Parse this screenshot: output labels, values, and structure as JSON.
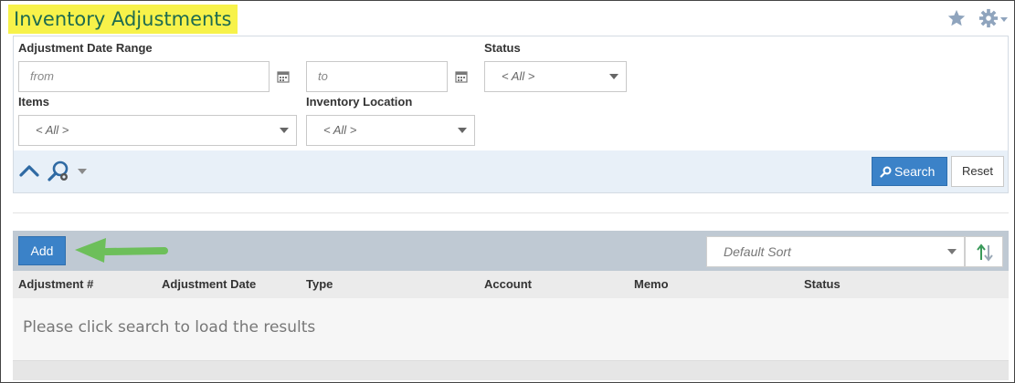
{
  "header": {
    "title": "Inventory Adjustments"
  },
  "filters": {
    "date_range_label": "Adjustment Date Range",
    "from_placeholder": "from",
    "to_placeholder": "to",
    "status_label": "Status",
    "status_value": "< All >",
    "items_label": "Items",
    "items_value": "< All >",
    "location_label": "Inventory Location",
    "location_value": "< All >"
  },
  "actions": {
    "search_label": "Search",
    "reset_label": "Reset"
  },
  "results": {
    "add_label": "Add",
    "sort_value": "Default Sort",
    "columns": [
      "Adjustment #",
      "Adjustment Date",
      "Type",
      "Account",
      "Memo",
      "Status"
    ],
    "empty_message": "Please click search to load the results"
  },
  "colors": {
    "title_highlight": "#f7f24a",
    "title_text": "#1e6b4f",
    "primary_button": "#3b82c8",
    "annotation_arrow": "#6dbf5a"
  }
}
